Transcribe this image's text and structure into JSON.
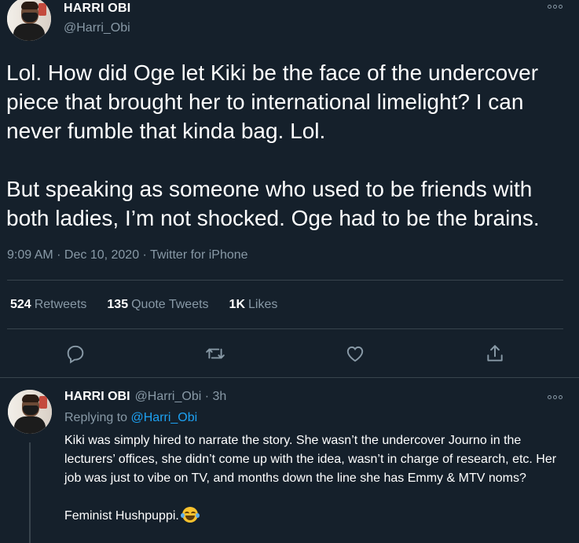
{
  "tweet": {
    "author_name": "HARRI OBI",
    "author_handle": "@Harri_Obi",
    "paragraphs": [
      "Lol. How did Oge let Kiki be the face of the undercover piece that brought her to international limelight? I can never fumble that kinda bag. Lol.",
      "But speaking as someone who used to be friends with both ladies, I’m not shocked. Oge had to be the brains."
    ],
    "meta": "9:09 AM · Dec 10, 2020 · Twitter for iPhone",
    "stats": {
      "retweets_count": "524",
      "retweets_label": "Retweets",
      "quotes_count": "135",
      "quotes_label": "Quote Tweets",
      "likes_count": "1K",
      "likes_label": "Likes"
    },
    "actions": [
      "reply-icon",
      "retweet-icon",
      "like-icon",
      "share-icon"
    ]
  },
  "reply": {
    "author_name": "HARRI OBI",
    "handle_time": "@Harri_Obi · 3h",
    "replying_prefix": "Replying to ",
    "replying_to": "@Harri_Obi",
    "paragraph1": "Kiki was simply hired to narrate the story. She wasn’t the undercover Journo in the lecturers’ offices, she didn’t come up with the idea, wasn’t in charge of research, etc. Her job was just to vibe on TV, and months down the line she has Emmy & MTV noms?",
    "paragraph2": "Feminist Hushpuppi.",
    "emoji": "face-with-tears-of-joy-emoji"
  },
  "colors": {
    "background": "#15202b",
    "text": "#ffffff",
    "secondary": "#8899a6",
    "link": "#1da1f2",
    "divider": "#38444d"
  }
}
